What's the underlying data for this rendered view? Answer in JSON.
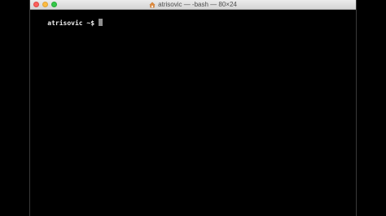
{
  "window": {
    "title": "atrisovic — -bash — 80×24"
  },
  "terminal": {
    "prompt": "atrisovic ~$"
  },
  "icons": {
    "title_icon": "home-folder-icon"
  },
  "colors": {
    "close": "#fc615d",
    "minimize": "#fdbc40",
    "zoom": "#34c84a",
    "terminal_bg": "#000000",
    "terminal_fg": "#f0f0f0"
  }
}
